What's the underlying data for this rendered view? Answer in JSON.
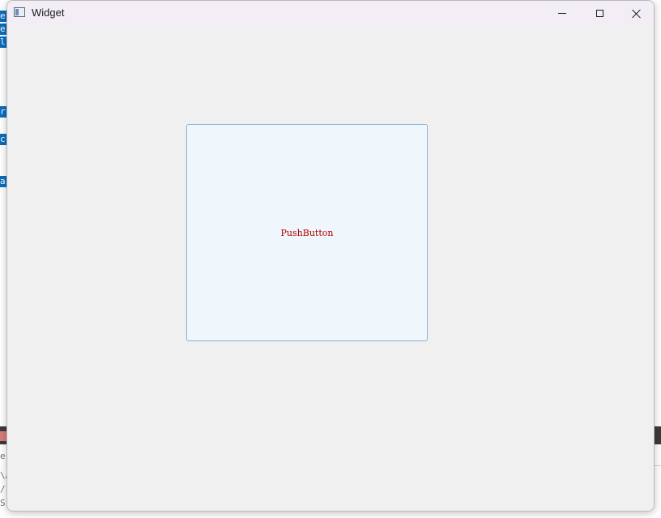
{
  "window": {
    "title": "Widget",
    "controls": {
      "minimize_icon": "minimize-icon",
      "maximize_icon": "maximize-icon",
      "close_icon": "close-icon"
    }
  },
  "main": {
    "push_button_label": "PushButton",
    "push_button_text_color": "#b00000",
    "push_button_border_color": "#8bb3d6"
  },
  "background": {
    "selection_fragments": [
      "e",
      "e",
      "l",
      "r",
      "c",
      "a"
    ],
    "bottom_fragments": [
      "es",
      "\\A",
      "/",
      "S"
    ]
  }
}
